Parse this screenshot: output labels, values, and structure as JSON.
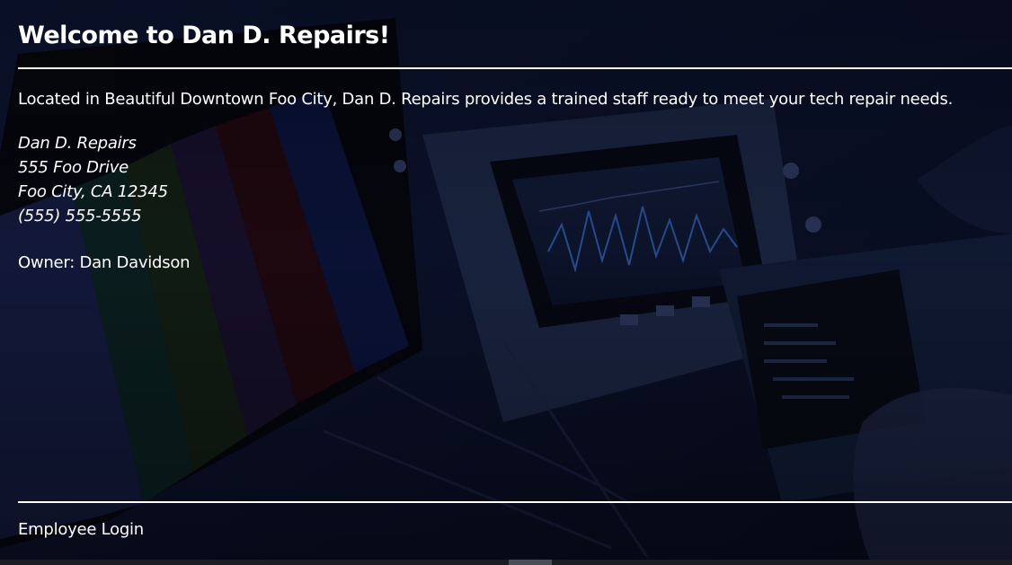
{
  "header": {
    "title": "Welcome to Dan D. Repairs!"
  },
  "main": {
    "intro": "Located in Beautiful Downtown Foo City, Dan D. Repairs provides a trained staff ready to meet your tech repair needs.",
    "address": {
      "name": "Dan D. Repairs",
      "street": "555 Foo Drive",
      "city_state_zip": "Foo City, CA 12345",
      "phone": "(555) 555-5555"
    },
    "owner": "Owner: Dan Davidson"
  },
  "footer": {
    "employee_login": "Employee Login"
  },
  "background": {
    "subject": "electronics repair bench with oscilloscope and color-bar test screen",
    "tint": "#0b1230"
  },
  "colors": {
    "text": "#ffffff",
    "rule": "#ffffff",
    "background": "#05070f"
  }
}
